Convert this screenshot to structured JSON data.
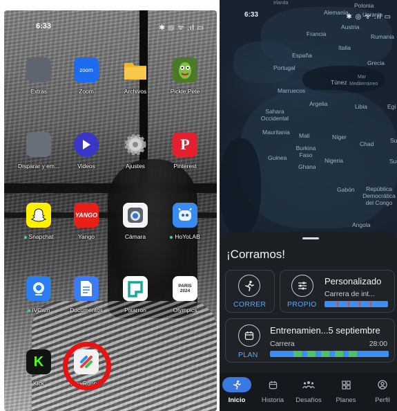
{
  "left_phone": {
    "status": {
      "time": "6:33",
      "icons": "✱ ◎ ᯤ .ıl ▭"
    },
    "apps": [
      {
        "name": "extras",
        "label": "Extras",
        "icon": "folder-grid-icon",
        "notif": false
      },
      {
        "name": "zoom",
        "label": "Zoom",
        "icon": "zoom-icon",
        "glyph": "zoom",
        "notif": false
      },
      {
        "name": "archivos",
        "label": "Archivos",
        "icon": "folder-icon",
        "notif": false
      },
      {
        "name": "pickle-pete",
        "label": "Pickle Pete",
        "icon": "pickle-pete-icon",
        "notif": false
      },
      {
        "name": "disparar",
        "label": "Disparar y em...",
        "icon": "folder-grid-icon",
        "notif": false
      },
      {
        "name": "videos",
        "label": "Videos",
        "icon": "play-icon",
        "notif": false
      },
      {
        "name": "ajustes",
        "label": "Ajustes",
        "icon": "gear-icon",
        "notif": false
      },
      {
        "name": "pinterest",
        "label": "Pinterest",
        "icon": "pinterest-icon",
        "glyph": "P",
        "notif": false
      },
      {
        "name": "snapchat",
        "label": "Snapchat",
        "icon": "snapchat-icon",
        "notif": true
      },
      {
        "name": "yango",
        "label": "Yango",
        "icon": "yango-icon",
        "glyph": "YANGO",
        "notif": false
      },
      {
        "name": "camara",
        "label": "Cámara",
        "icon": "camera-icon",
        "notif": false
      },
      {
        "name": "hoyolab",
        "label": "HoYoLAB",
        "icon": "hoyolab-icon",
        "notif": true
      },
      {
        "name": "ivcam",
        "label": "iVCam",
        "icon": "webcam-icon",
        "notif": true
      },
      {
        "name": "documentos",
        "label": "Documentos",
        "icon": "document-icon",
        "notif": false
      },
      {
        "name": "pixarron",
        "label": "Pixarron",
        "icon": "pixarron-icon",
        "notif": false
      },
      {
        "name": "olympics",
        "label": "Olympics",
        "icon": "olympics-icon",
        "glyph": "PARIS 2024",
        "notif": false
      },
      {
        "name": "kick",
        "label": "Kick",
        "icon": "kick-icon",
        "glyph": "K",
        "notif": false
      },
      {
        "name": "flowrunner",
        "label": "FlowRunner",
        "icon": "runner-icon",
        "notif": false
      }
    ],
    "highlight_color": "#e81212"
  },
  "right_phone": {
    "status": {
      "time": "6:33",
      "icons": "✱ ◎ ᯤ .ıl ▭"
    },
    "map_labels": [
      {
        "text": "Irlanda"
      },
      {
        "text": "Polonia"
      },
      {
        "text": "Alemania"
      },
      {
        "text": "Ucrania"
      },
      {
        "text": "Austria"
      },
      {
        "text": "Francia"
      },
      {
        "text": "Rumania"
      },
      {
        "text": "Italia"
      },
      {
        "text": "España"
      },
      {
        "text": "Portugal"
      },
      {
        "text": "Grecia"
      },
      {
        "text": "Túnez"
      },
      {
        "text": "Mar Mediterráneo"
      },
      {
        "text": "Marruecos"
      },
      {
        "text": "Argelia"
      },
      {
        "text": "Libia"
      },
      {
        "text": "Egi"
      },
      {
        "text": "Sahara Occidental"
      },
      {
        "text": "Mauritania"
      },
      {
        "text": "Mali"
      },
      {
        "text": "Níger"
      },
      {
        "text": "Chad"
      },
      {
        "text": "Su"
      },
      {
        "text": "Burkina Faso"
      },
      {
        "text": "Guinea"
      },
      {
        "text": "Nigeria"
      },
      {
        "text": "Ghana"
      },
      {
        "text": "Gabón"
      },
      {
        "text": "República Democrática del Congo"
      },
      {
        "text": "Angola"
      },
      {
        "text": "Sudá"
      }
    ],
    "sheet": {
      "title": "¡Corramos!",
      "correr": {
        "label": "CORRER",
        "icon": "running-icon"
      },
      "propio": {
        "label": "PROPIO",
        "icon": "sliders-icon",
        "title": "Personalizado",
        "subtitle": "Carrera de int..."
      },
      "plan": {
        "label": "PLAN",
        "icon": "calendar-icon",
        "title": "Entrenamien...5 septiembre",
        "activity": "Carrera",
        "duration": "28:00"
      },
      "accent_color": "#3a8ff0",
      "interval_color": "#e04848",
      "plan_segment_color": "#4fbf68"
    },
    "nav": [
      {
        "name": "inicio",
        "label": "Inicio",
        "icon": "running-icon",
        "active": true
      },
      {
        "name": "historia",
        "label": "Historia",
        "icon": "calendar-icon",
        "active": false
      },
      {
        "name": "desafios",
        "label": "Desafíos",
        "icon": "group-icon",
        "active": false
      },
      {
        "name": "planes",
        "label": "Planes",
        "icon": "grid-icon",
        "active": false
      },
      {
        "name": "perfil",
        "label": "Perfil",
        "icon": "profile-icon",
        "active": false
      }
    ]
  }
}
